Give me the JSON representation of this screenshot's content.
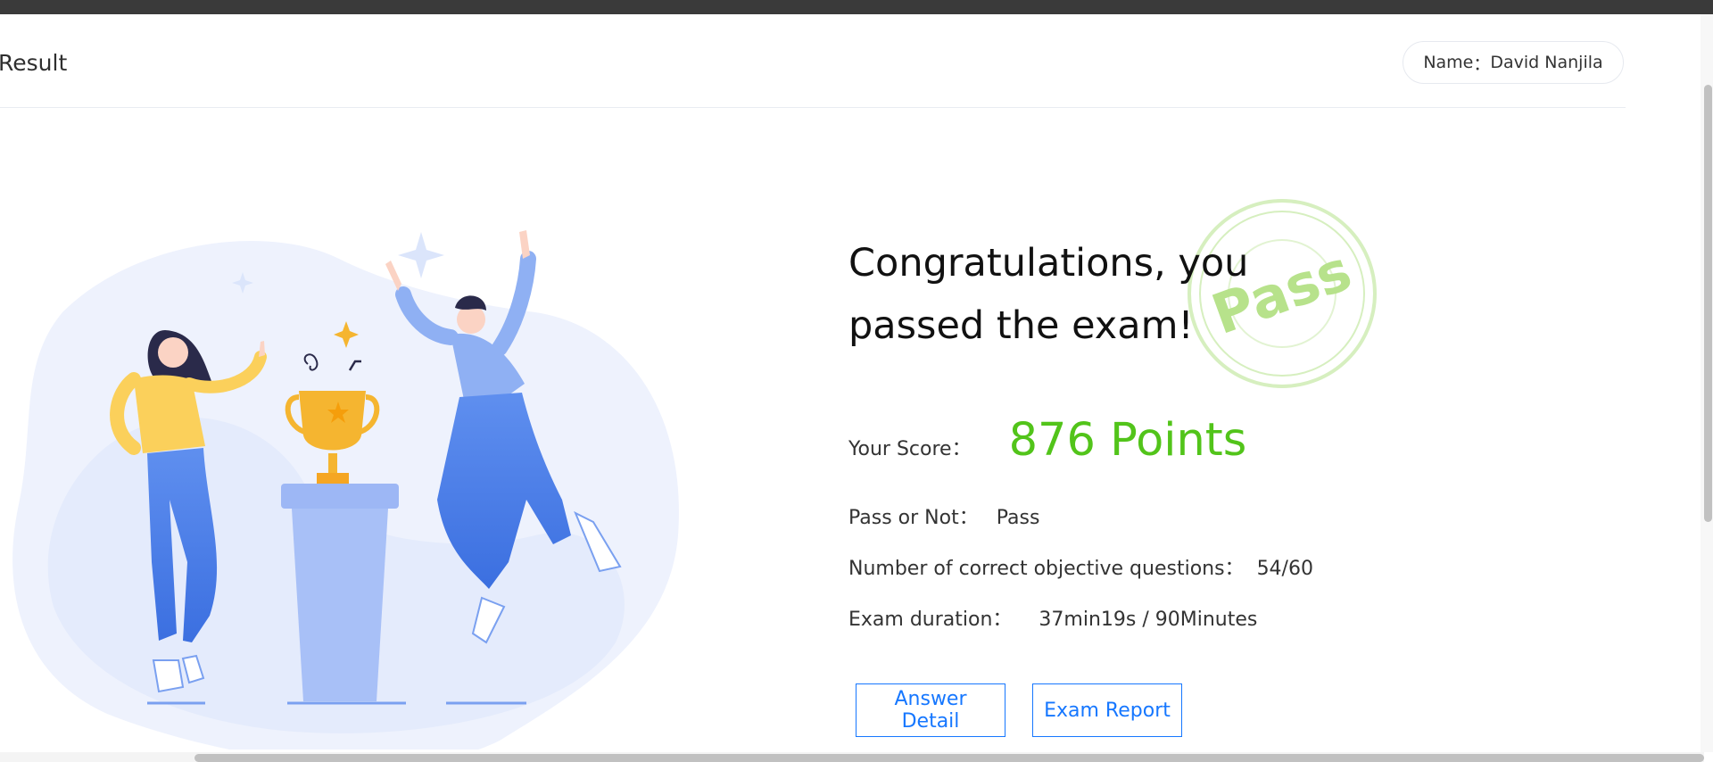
{
  "header": {
    "title": "Result",
    "name_label": "Name",
    "name_sep": "：",
    "name_value": "David Nanjila"
  },
  "stamp": {
    "text": "Pass"
  },
  "result": {
    "headline": "Congratulations, you passed the exam!",
    "score_label": "Your Score：",
    "score_value": "876 Points",
    "pass_label": "Pass or Not：",
    "pass_value": "Pass",
    "correct_label": "Number of correct objective questions：",
    "correct_value": "54/60",
    "duration_label": "Exam duration：",
    "duration_value": "37min19s / 90Minutes"
  },
  "buttons": {
    "answer_detail": "Answer Detail",
    "exam_report": "Exam Report"
  },
  "colors": {
    "accent": "#1677ff",
    "score": "#52c41a",
    "stamp": "#b7e28b"
  }
}
